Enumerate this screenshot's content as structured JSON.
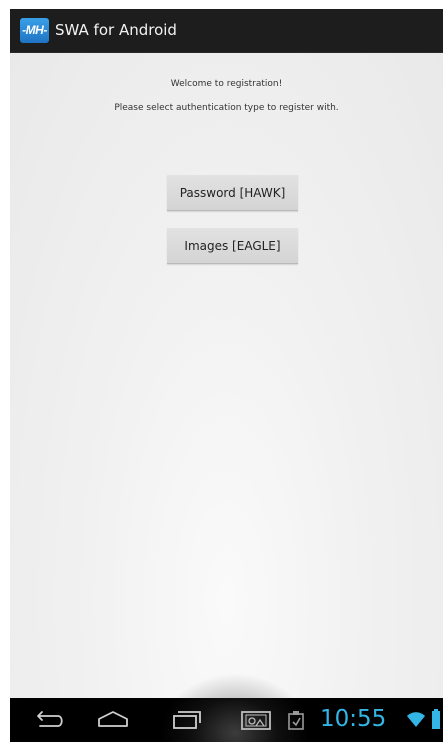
{
  "action_bar": {
    "logo_text": "-MH-",
    "title": "SWA for Android"
  },
  "content": {
    "welcome_text": "Welcome to registration!",
    "instruction_text": "Please select authentication type to register with.",
    "buttons": {
      "password_label": "Password [HAWK]",
      "images_label": "Images [EAGLE]"
    }
  },
  "system_bar": {
    "time": "10:55",
    "icons": [
      "back-icon",
      "home-icon",
      "recent-apps-icon",
      "screenshot-icon",
      "clipboard-icon",
      "wifi-icon",
      "battery-icon"
    ]
  },
  "colors": {
    "action_bar": "#1d1d1d",
    "accent_clock": "#33b5e5",
    "button_bg": "#dcdcdc"
  }
}
